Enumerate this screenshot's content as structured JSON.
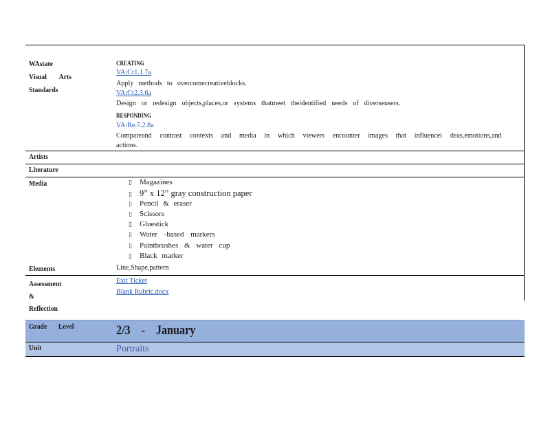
{
  "standards": {
    "label": "WAstate Visual Arts Standards",
    "creating_heading": "CREATING",
    "creating_link1": "VA:Cr1.1.7a",
    "creating_text1": "Apply methods to overcomecreativeblocks.",
    "creating_link2": "VA:Cr2.3.6a",
    "creating_text2": "Design or redesign objects,places,or systems thatmeet theidentified needs of diverseusers.",
    "responding_heading": "RESPONDING",
    "responding_link": "VA:Re.7.2.8a",
    "responding_text_line1": "Compareand contrast contexts and media in which viewers encounter images that influencei deas,emotions,and",
    "responding_text_line2": "actions."
  },
  "rows": {
    "artists": "Artists",
    "literature": "Literature",
    "media": "Media",
    "elements": "Elements",
    "elements_value": "Line,Shape,pattern",
    "assessment": "Assessment & Reflection",
    "assessment_link1": "Exit Ticket",
    "assessment_link2": "Blank Rubric.docx"
  },
  "media_items": [
    "Magazines",
    "9” x 12” gray construction paper",
    "Pencil & eraser",
    "Scissors",
    "Gluestick",
    "Water -based markers",
    "Paintbrushes & water cup",
    "Black marker"
  ],
  "bullet_glyph": "▯",
  "header_table": {
    "grade_label": "Grade Level",
    "grade_value": "2/3 - January",
    "unit_label": "Unit",
    "unit_value": "Portraits"
  },
  "colors": {
    "link": "#1f56b3",
    "grade_band": "#95b0dc",
    "unit_band": "#b4c6e7",
    "unit_text": "#3a5fa6"
  }
}
